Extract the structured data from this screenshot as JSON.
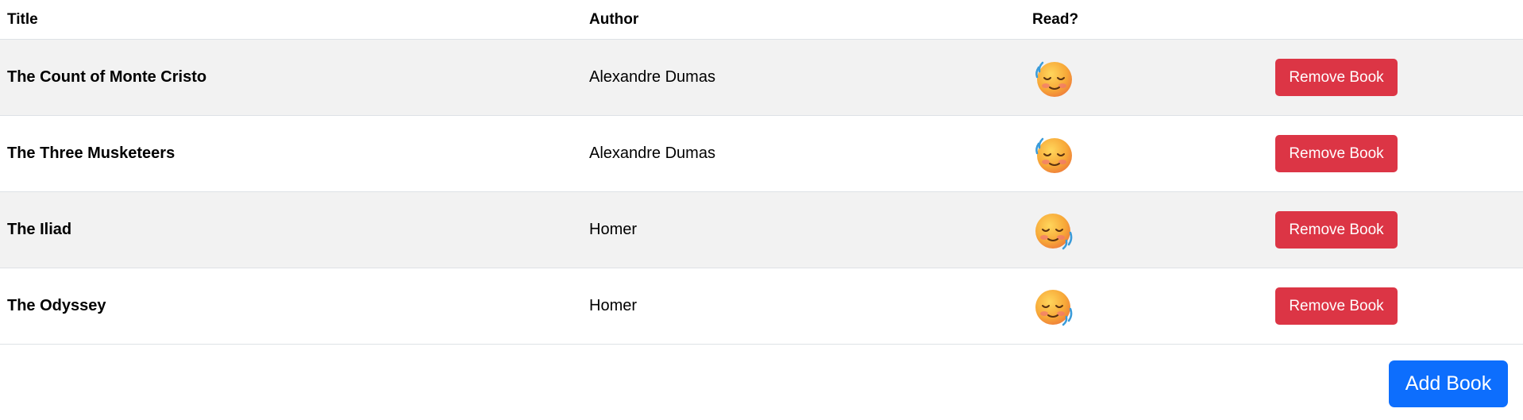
{
  "table": {
    "headers": {
      "title": "Title",
      "author": "Author",
      "read": "Read?"
    },
    "rows": [
      {
        "title": "The Count of Monte Cristo",
        "author": "Alexandre Dumas",
        "read_icon": "relieved-face-waving-icon",
        "remove_label": "Remove Book"
      },
      {
        "title": "The Three Musketeers",
        "author": "Alexandre Dumas",
        "read_icon": "relieved-face-waving-icon",
        "remove_label": "Remove Book"
      },
      {
        "title": "The Iliad",
        "author": "Homer",
        "read_icon": "relieved-face-shaking-icon",
        "remove_label": "Remove Book"
      },
      {
        "title": "The Odyssey",
        "author": "Homer",
        "read_icon": "relieved-face-shaking-icon",
        "remove_label": "Remove Book"
      }
    ]
  },
  "actions": {
    "add_label": "Add Book"
  },
  "colors": {
    "danger": "#dc3545",
    "primary": "#0d6efd",
    "stripe": "#f2f2f2"
  }
}
